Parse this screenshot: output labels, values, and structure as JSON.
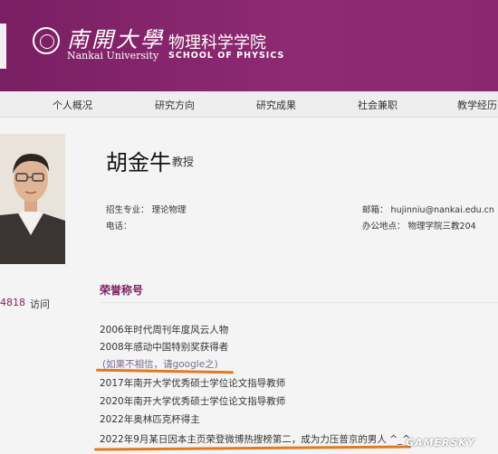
{
  "header": {
    "logo_cn": "南開大學",
    "logo_en": "Nankai University",
    "school_cn": "物理科学学院",
    "school_en": "SCHOOL OF PHYSICS"
  },
  "nav": {
    "items": [
      {
        "label": "个人概况"
      },
      {
        "label": "研究方向"
      },
      {
        "label": "研究成果"
      },
      {
        "label": "社会兼职"
      },
      {
        "label": "教学经历"
      }
    ]
  },
  "profile": {
    "name": "胡金牛",
    "title": "教授",
    "major_label": "招生专业：",
    "major_value": "理论物理",
    "phone_label": "电话：",
    "phone_value": "",
    "email_label": "邮箱：",
    "email_value": "hujinniu@nankai.edu.cn",
    "office_label": "办公地点：",
    "office_value": "物理学院三教204",
    "visit_count": "4818",
    "visit_label": "访问"
  },
  "honors": {
    "section_title": "荣誉称号",
    "items": [
      "2006年时代周刊年度风云人物",
      "2008年感动中国特别奖获得者",
      "(如果不相信，请google之)",
      "2017年南开大学优秀硕士学位论文指导教师",
      "2020年南开大学优秀硕士学位论文指导教师",
      "2022年奥林匹克杯得主",
      "2022年9月某日因本主页荣登微博热搜榜第二，成为力压普京的男人 ^_^"
    ]
  },
  "watermark": "GAMERSKY",
  "colors": {
    "header_bg": "#7a1f63",
    "nav_bg": "#eeeeee",
    "accent": "#7a1f63",
    "underline": "#e07b22"
  }
}
